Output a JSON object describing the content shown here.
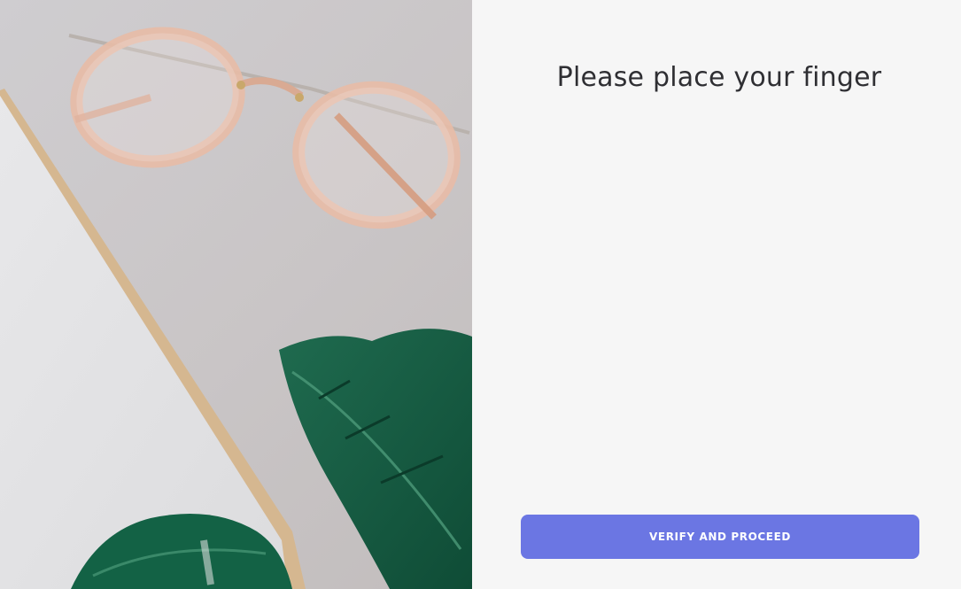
{
  "hero": {
    "image": "glasses-and-leaves-photo"
  },
  "verify": {
    "title": "Please place your finger",
    "button_label": "VERIFY AND PROCEED",
    "accent_color": "#6b76e3"
  }
}
